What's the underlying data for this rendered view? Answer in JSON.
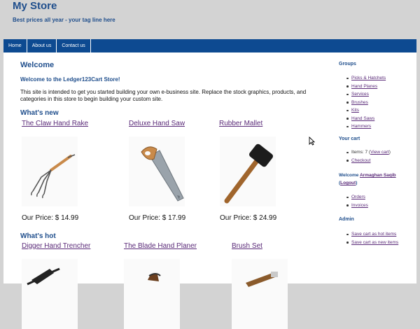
{
  "header": {
    "site_title": "My Store",
    "tagline": "Best prices all year - your tag line here"
  },
  "nav": {
    "items": [
      "Home",
      "About us",
      "Contact us"
    ]
  },
  "main": {
    "welcome_heading": "Welcome",
    "welcome_sub": "Welcome to the Ledger123Cart Store!",
    "intro": "This site is intended to get you started building your own e-business site. Replace the stock graphics, products, and categories in this store to begin building your custom site.",
    "whats_new_heading": "What's new",
    "whats_hot_heading": "What's hot",
    "new_products": [
      {
        "name": "The Claw Hand Rake",
        "price": "Our Price: $ 14.99",
        "icon": "hand-rake-icon"
      },
      {
        "name": "Deluxe Hand Saw",
        "price": "Our Price: $ 17.99",
        "icon": "hand-saw-icon"
      },
      {
        "name": "Rubber Mallet",
        "price": "Our Price: $ 24.99",
        "icon": "mallet-icon"
      }
    ],
    "hot_products": [
      {
        "name": "Digger Hand Trencher",
        "icon": "trencher-icon"
      },
      {
        "name": "The Blade Hand Planer",
        "icon": "hand-planer-icon"
      },
      {
        "name": "Brush Set",
        "icon": "brush-icon"
      }
    ]
  },
  "sidebar": {
    "groups_heading": "Groups",
    "groups": [
      "Picks & Hatchets",
      "Hand Planes",
      "Services",
      "Brushes",
      "Kits",
      "Hand Saws",
      "Hammers"
    ],
    "cart_heading": "Your cart",
    "cart_items_text": "Items: 7 (",
    "view_cart": "View cart",
    "cart_close": ")",
    "checkout": "Checkout",
    "welcome_prefix": "Welcome ",
    "user_name": "Armaghan Saqib",
    "logout_open": "(",
    "logout": "Logout",
    "logout_close": ")",
    "account_links": [
      "Orders",
      "Invoices"
    ],
    "admin_heading": "Admin",
    "admin_links": [
      "Save cart as hot items",
      "Save cart as new items"
    ]
  },
  "colors": {
    "heading_blue": "#1f4e8c",
    "nav_blue": "#0d4a91",
    "link_purple": "#5a2a78",
    "background_gray": "#d3d3d3"
  }
}
